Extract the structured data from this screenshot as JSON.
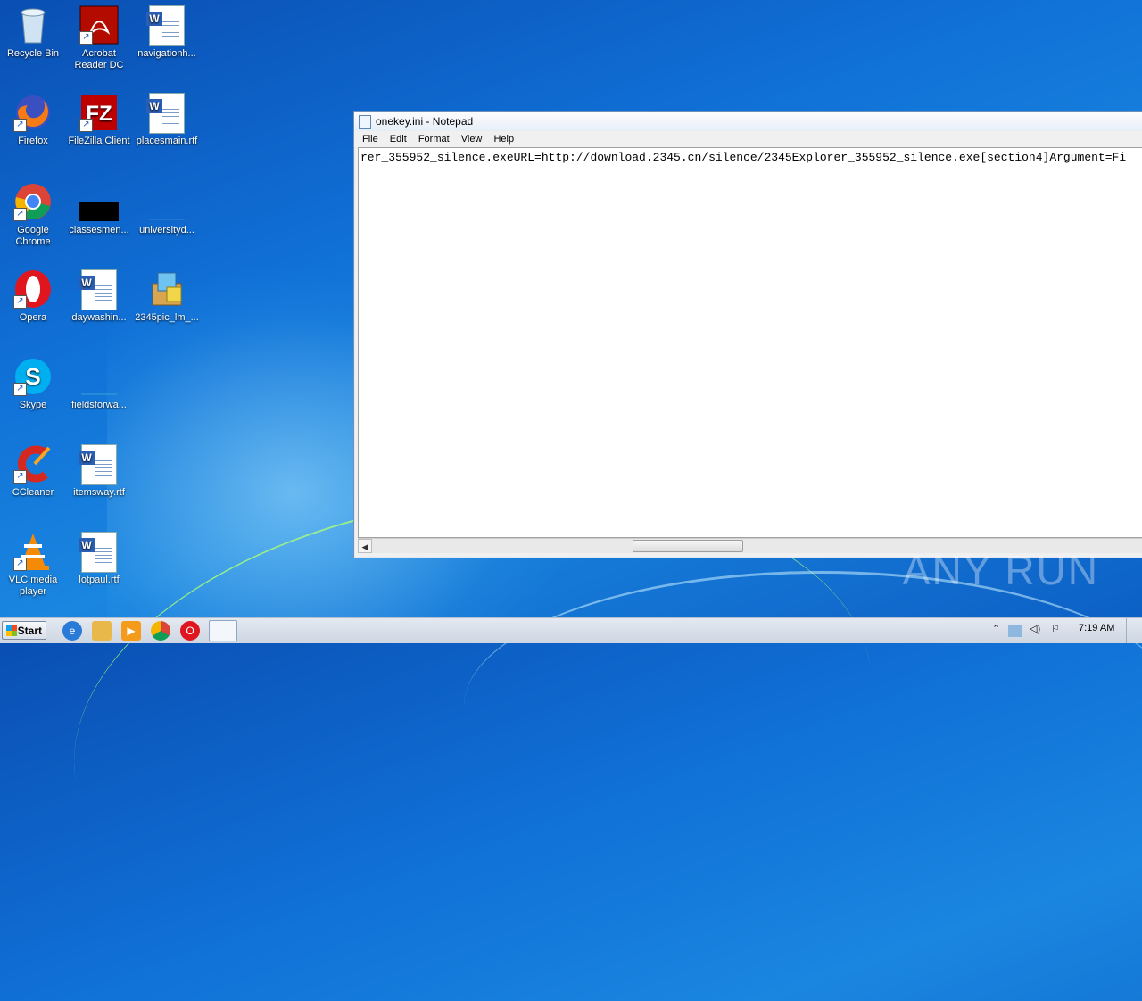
{
  "desktop": {
    "icons": [
      {
        "label": "Recycle Bin",
        "icon": "recycle-bin-icon"
      },
      {
        "label": "Acrobat Reader DC",
        "icon": "acrobat-icon"
      },
      {
        "label": "navigationh...",
        "icon": "word-doc-icon"
      },
      {
        "label": "Firefox",
        "icon": "firefox-icon"
      },
      {
        "label": "FileZilla Client",
        "icon": "filezilla-icon"
      },
      {
        "label": "placesmain.rtf",
        "icon": "word-doc-icon"
      },
      {
        "label": "Google Chrome",
        "icon": "chrome-icon"
      },
      {
        "label": "classesmen...",
        "icon": "black-file-icon"
      },
      {
        "label": "universityd...",
        "icon": "blank-file-icon"
      },
      {
        "label": "Opera",
        "icon": "opera-icon"
      },
      {
        "label": "daywashin...",
        "icon": "word-doc-icon"
      },
      {
        "label": "2345pic_lm_...",
        "icon": "installer-icon"
      },
      {
        "label": "Skype",
        "icon": "skype-icon"
      },
      {
        "label": "fieldsforwa...",
        "icon": "blank-file-icon"
      },
      {
        "label": "CCleaner",
        "icon": "ccleaner-icon"
      },
      {
        "label": "itemsway.rtf",
        "icon": "word-doc-icon"
      },
      {
        "label": "VLC media player",
        "icon": "vlc-icon"
      },
      {
        "label": "lotpaul.rtf",
        "icon": "word-doc-icon"
      }
    ]
  },
  "notepad": {
    "title": "onekey.ini - Notepad",
    "menu": [
      "File",
      "Edit",
      "Format",
      "View",
      "Help"
    ],
    "content": "rer_355952_silence.exeURL=http://download.2345.cn/silence/2345Explorer_355952_silence.exe[section4]Argument=Fi"
  },
  "watermark": "ANY RUN",
  "taskbar": {
    "start_label": "Start",
    "clock": "7:19 AM"
  },
  "colors": {
    "desktop_bg": "#1070d6",
    "taskbar_bg": "#d8dee8"
  }
}
